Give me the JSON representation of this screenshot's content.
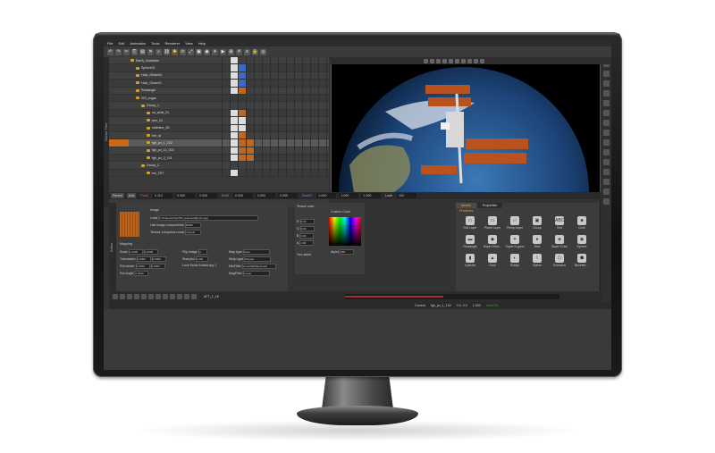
{
  "menu": [
    "File",
    "Edit",
    "Animation",
    "Tools",
    "Renderer",
    "View",
    "Help"
  ],
  "scene_tree": {
    "label": "Scene Tree",
    "rows": [
      "Earth_Container",
      "Sphere01",
      "Halo_Globe04",
      "Halo_Globe01",
      "Rectangle",
      "ISS_sugar",
      "Group_1",
      "sd_wrist_01",
      "arm_01",
      "sideblue_08",
      "frm_st",
      "fgb_pv_1_102",
      "fgb_pv_11_002",
      "fgb_pv_2_101",
      "Group_2",
      "sm_2ST"
    ]
  },
  "property_bar": {
    "parent": "Parent",
    "axis": "Axis",
    "pos_label": "PosX",
    "pos_x": "0.113",
    "pos_y": "0.000",
    "pos_z": "0.000",
    "rot_label": "RotX",
    "rot_x": "0.000",
    "rot_y": "0.000",
    "rot_z": "0.000",
    "scale_label": "ScaleX",
    "scale_x": "1.000",
    "scale_y": "1.000",
    "scale_z": "1.000",
    "lock_label": "Lock",
    "lock_val": "102"
  },
  "image_panel": {
    "label": "Editor",
    "image": "Image",
    "load": "Load",
    "path": "C:/Projects/Ops/ISS_textures/fgb-sun.jpg",
    "use_components": "Use image components",
    "rgba": "RGBA",
    "compress": "Texture compress mode",
    "compress_val": "Default",
    "mapping": "Mapping",
    "scale": "Scale",
    "scale_v1": "1.0000",
    "scale_v2": "1.0000",
    "translation": "Translation",
    "tr_v1": "0.0000",
    "tr_v2": "0.0000",
    "rot_center": "Rot center",
    "rc_v1": "0.5000",
    "rc_v2": "0.5000",
    "rot_angle": "Rot angle",
    "ra_v1": "0.0000",
    "flip": "Flip image",
    "flip_val": "H",
    "map_type": "Map type",
    "map_type_val": "None",
    "wrap": "Wrap type",
    "wrap_val": "Repeat",
    "minfilter": "MinFilter",
    "minfilter_val": "LinearMipMapLinear",
    "sharpen": "Sharpen",
    "sharpen_val": "0.000",
    "lock_scale": "Lock Scale",
    "anisotropy": "Anisotropy",
    "aniso_val": "1",
    "magfilter": "MagFilter",
    "magfilter_val": "Linear"
  },
  "color_panel": {
    "title": "Tensor color",
    "custom": "Custom Color",
    "r": "R",
    "g": "G",
    "b": "B",
    "a": "A",
    "r_val": "0.00",
    "g_val": "0.00",
    "b_val": "0.00",
    "a_val": "1.00",
    "two_sided": "Two sided",
    "alpha": "Alpha",
    "alpha_val": "255"
  },
  "nodes": {
    "tabs": [
      "Assets",
      "Properties"
    ],
    "sub": "Primitives",
    "items": [
      "Flat Layer",
      "Plane Layer",
      "Persp Layer",
      "Group",
      "Text",
      "Cube",
      "Rectangle",
      "Super Tetra...",
      "Super N-gons",
      "Disk",
      "Super Cube",
      "Sphere",
      "Cylinder",
      "Cone",
      "Rotary",
      "Spline",
      "Extrusion",
      "Beveled ..."
    ],
    "glyphs": [
      "▭",
      "▭",
      "▱",
      "▣",
      "ABC",
      "■",
      "▬",
      "◆",
      "✦",
      "●",
      "◈",
      "◉",
      "▮",
      "▲",
      "◐",
      "⌇",
      "⬡",
      "⬢"
    ]
  },
  "timeline": {
    "frame": "AFT_1_16",
    "current_label": "Current",
    "current": "fgb_pv_1_102",
    "level": "Level 91",
    "zoom": "0.0, 0.0",
    "count": "1.000"
  },
  "colors": {
    "accent": "#c86a1a",
    "bg": "#333333"
  }
}
